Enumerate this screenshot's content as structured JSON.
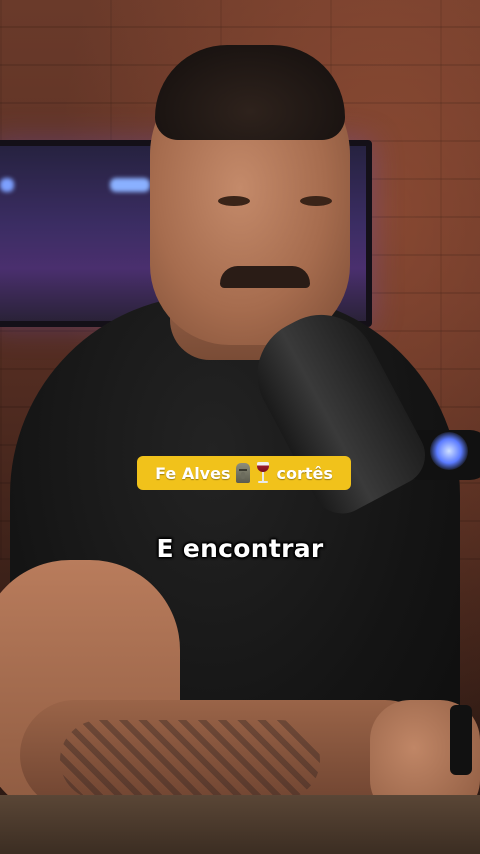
{
  "video": {
    "channel_badge": {
      "name": "Fe Alves",
      "suffix": "cortês",
      "icons": [
        "moai-icon",
        "wine-glass-icon"
      ],
      "background_color": "#f1c21b",
      "text_color": "#ffffff"
    },
    "caption": {
      "text": "E encontrar",
      "color": "#ffffff"
    }
  }
}
